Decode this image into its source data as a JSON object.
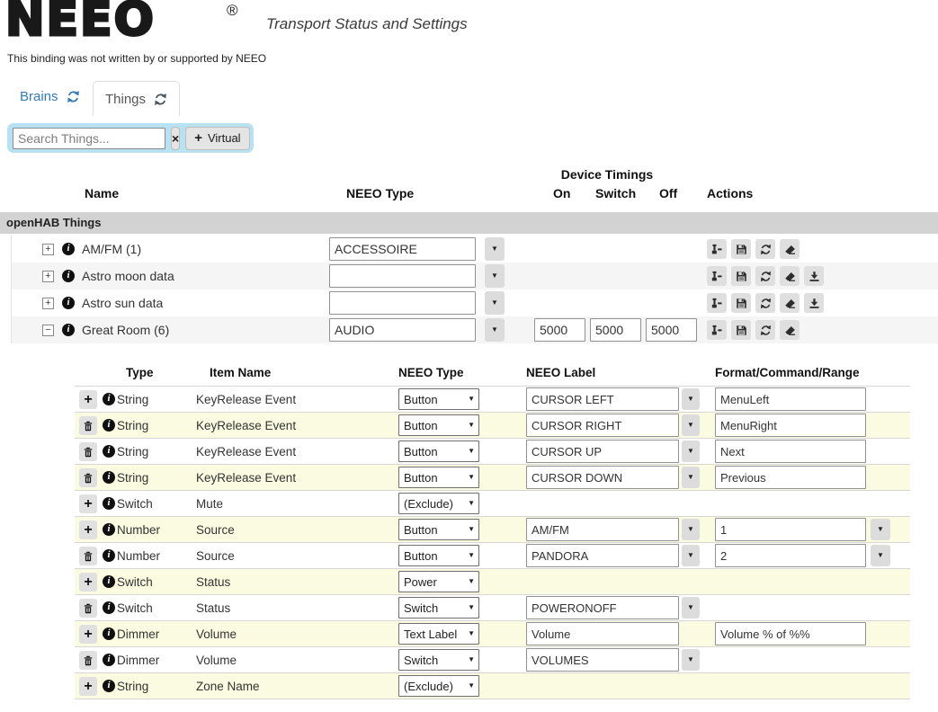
{
  "header": {
    "logo": "NEEO",
    "logo_registered": "®",
    "tagline": "Transport Status and Settings",
    "disclaimer": "This binding was not written by or supported by NEEO"
  },
  "tabs": [
    {
      "label": "Brains",
      "active": false
    },
    {
      "label": "Things",
      "active": true
    }
  ],
  "search": {
    "placeholder": "Search Things...",
    "clear_label": "×",
    "virtual_plus": "+",
    "virtual_label": "Virtual"
  },
  "things_table": {
    "group_header": "Device Timings",
    "columns": {
      "name": "Name",
      "neeo_type": "NEEO Type",
      "on": "On",
      "switch": "Switch",
      "off": "Off",
      "actions": "Actions"
    },
    "section_title": "openHAB Things",
    "rows": [
      {
        "expander": "collapsed",
        "name": "AM/FM (1)",
        "neeo_type": "ACCESSOIRE",
        "timings": null,
        "actions": [
          "gavel",
          "save",
          "refresh",
          "eraser"
        ],
        "striped": false
      },
      {
        "expander": "collapsed",
        "name": "Astro moon data",
        "neeo_type": "",
        "timings": null,
        "actions": [
          "gavel",
          "save",
          "refresh",
          "eraser",
          "download"
        ],
        "striped": true
      },
      {
        "expander": "collapsed",
        "name": "Astro sun data",
        "neeo_type": "",
        "timings": null,
        "actions": [
          "gavel",
          "save",
          "refresh",
          "eraser",
          "download"
        ],
        "striped": false
      },
      {
        "expander": "expanded",
        "name": "Great Room (6)",
        "neeo_type": "AUDIO",
        "timings": [
          "5000",
          "5000",
          "5000"
        ],
        "actions": [
          "gavel",
          "save",
          "refresh",
          "eraser"
        ],
        "striped": true
      }
    ]
  },
  "items_table": {
    "columns": {
      "type": "Type",
      "item": "Item Name",
      "neeo_type": "NEEO Type",
      "label": "NEEO Label",
      "format": "Format/Command/Range"
    },
    "rows": [
      {
        "button": "add",
        "type": "String",
        "item": "KeyRelease Event",
        "neeo_type": "Button",
        "label": {
          "value": "CURSOR LEFT",
          "caret": true
        },
        "format": {
          "value": "MenuLeft",
          "caret": false
        },
        "striped": false
      },
      {
        "button": "delete",
        "type": "String",
        "item": "KeyRelease Event",
        "neeo_type": "Button",
        "label": {
          "value": "CURSOR RIGHT",
          "caret": true
        },
        "format": {
          "value": "MenuRight",
          "caret": false
        },
        "striped": true
      },
      {
        "button": "delete",
        "type": "String",
        "item": "KeyRelease Event",
        "neeo_type": "Button",
        "label": {
          "value": "CURSOR UP",
          "caret": true
        },
        "format": {
          "value": "Next",
          "caret": false
        },
        "striped": false
      },
      {
        "button": "delete",
        "type": "String",
        "item": "KeyRelease Event",
        "neeo_type": "Button",
        "label": {
          "value": "CURSOR DOWN",
          "caret": true
        },
        "format": {
          "value": "Previous",
          "caret": false
        },
        "striped": true
      },
      {
        "button": "add",
        "type": "Switch",
        "item": "Mute",
        "neeo_type": "(Exclude)",
        "label": null,
        "format": null,
        "striped": false
      },
      {
        "button": "add",
        "type": "Number",
        "item": "Source",
        "neeo_type": "Button",
        "label": {
          "value": "AM/FM",
          "caret": true
        },
        "format": {
          "value": "1",
          "caret": true
        },
        "striped": true
      },
      {
        "button": "delete",
        "type": "Number",
        "item": "Source",
        "neeo_type": "Button",
        "label": {
          "value": "PANDORA",
          "caret": true
        },
        "format": {
          "value": "2",
          "caret": true
        },
        "striped": false
      },
      {
        "button": "add",
        "type": "Switch",
        "item": "Status",
        "neeo_type": "Power",
        "label": null,
        "format": null,
        "striped": true
      },
      {
        "button": "delete",
        "type": "Switch",
        "item": "Status",
        "neeo_type": "Switch",
        "label": {
          "value": "POWERONOFF",
          "caret": true
        },
        "format": null,
        "striped": false
      },
      {
        "button": "add",
        "type": "Dimmer",
        "item": "Volume",
        "neeo_type": "Text Label",
        "label": {
          "value": "Volume",
          "caret": false
        },
        "format": {
          "value": "Volume % of %%",
          "caret": false
        },
        "striped": true
      },
      {
        "button": "delete",
        "type": "Dimmer",
        "item": "Volume",
        "neeo_type": "Switch",
        "label": {
          "value": "VOLUMES",
          "caret": true
        },
        "format": null,
        "striped": false
      },
      {
        "button": "add",
        "type": "String",
        "item": "Zone Name",
        "neeo_type": "(Exclude)",
        "label": null,
        "format": null,
        "striped": true
      }
    ]
  },
  "colors": {
    "accent_blue": "#337ab7",
    "search_panel": "#b8e1f1",
    "stripe_yellow": "#fbfbe1",
    "stripe_gray": "#f5f5f5",
    "section_bar": "#d2d2d2"
  }
}
